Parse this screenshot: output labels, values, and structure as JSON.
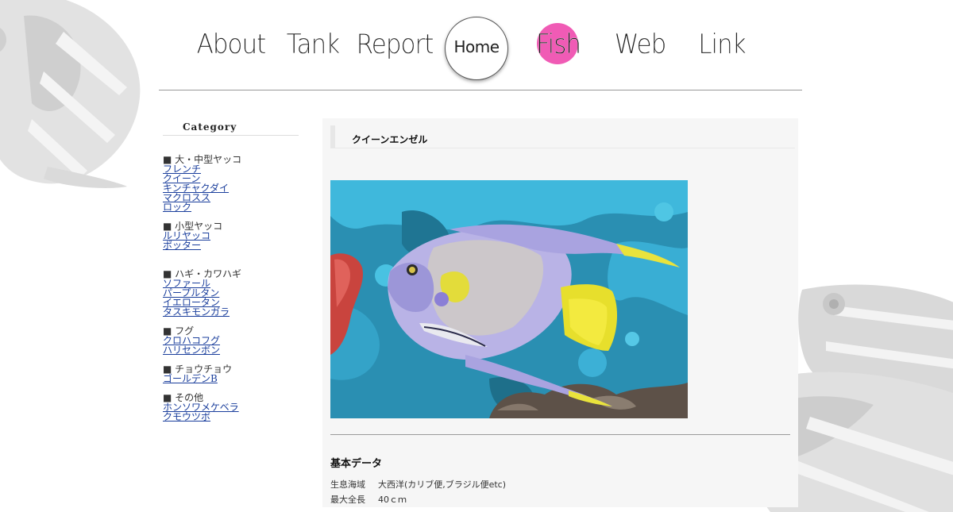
{
  "nav": {
    "items": [
      {
        "label": "About",
        "color": "#5a6ee8"
      },
      {
        "label": "Tank",
        "color": "#3fd3ea"
      },
      {
        "label": "Report",
        "color": "#37d92a"
      },
      {
        "label": "Home",
        "color": "#ffffff"
      },
      {
        "label": "Fish",
        "color": "#f05bb5"
      },
      {
        "label": "Web",
        "color": "#f39a3d"
      },
      {
        "label": "Link",
        "color": "#f0e33c"
      }
    ]
  },
  "sidebar": {
    "title": "Category",
    "groups": [
      {
        "head": "■ 大・中型ヤッコ",
        "links": [
          "フレンチ",
          "クイーン",
          "キンチャクダイ",
          "マクロスス",
          "ロック"
        ]
      },
      {
        "head": "■ 小型ヤッコ",
        "links": [
          "ルリヤッコ",
          "ポッター"
        ]
      },
      {
        "head": "■ ハギ・カワハギ",
        "links": [
          "ソファール",
          "パープルタン",
          "イエロータン",
          "タスキモンガラ"
        ]
      },
      {
        "head": "■ フグ",
        "links": [
          "クロハコフグ",
          "ハリセンボン"
        ]
      },
      {
        "head": "■ チョウチョウ",
        "links": [
          "ゴールデンB"
        ]
      },
      {
        "head": "■ その他",
        "links": [
          "ホンソワメケベラ",
          "クモウツボ"
        ]
      }
    ]
  },
  "article": {
    "title": "クイーンエンゼル",
    "data_heading": "基本データ",
    "rows": [
      {
        "key": "生息海域",
        "value": "大西洋(カリブ便,ブラジル便etc)"
      },
      {
        "key": "最大全長",
        "value": "40ｃｍ"
      }
    ]
  }
}
